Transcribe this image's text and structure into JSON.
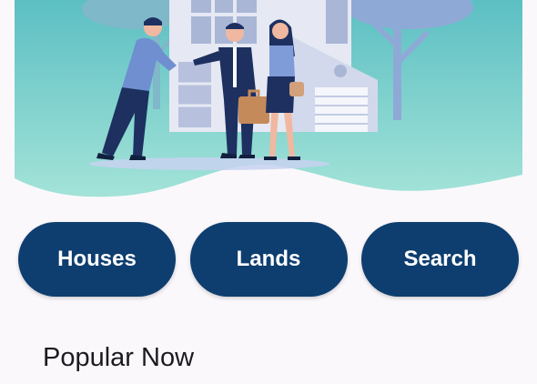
{
  "hero": {
    "illustration_icon": "real-estate-handshake-illustration",
    "background_top_color": "#5fc1c3",
    "background_bottom_color": "#9fe0d7"
  },
  "buttons": [
    {
      "label": "Houses"
    },
    {
      "label": "Lands"
    },
    {
      "label": "Search"
    }
  ],
  "button_color": "#0e3e6f",
  "section": {
    "title": "Popular Now"
  }
}
